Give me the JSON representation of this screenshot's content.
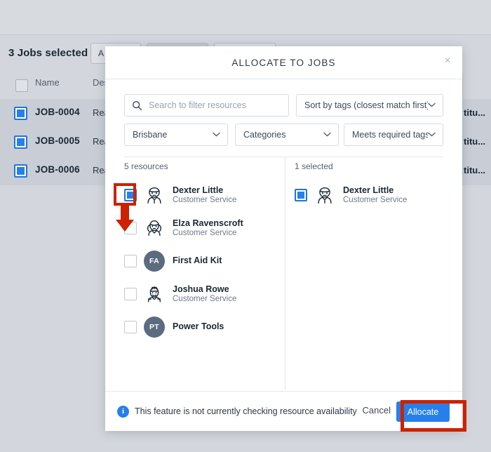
{
  "background": {
    "selection_label": "3 Jobs selected",
    "toolbar_buttons": [
      {
        "label": "A"
      },
      {
        "label": ""
      },
      {
        "label": ""
      }
    ],
    "table": {
      "columns": [
        "Name",
        "Des"
      ],
      "rows": [
        {
          "name": "JOB-0004",
          "description": "Rea",
          "tail": "titu..."
        },
        {
          "name": "JOB-0005",
          "description": "Rea",
          "tail": "titu..."
        },
        {
          "name": "JOB-0006",
          "description": "Rea",
          "tail": "titu..."
        }
      ]
    }
  },
  "modal": {
    "title": "ALLOCATE TO JOBS",
    "close_label": "×",
    "search": {
      "placeholder": "Search to filter resources",
      "value": ""
    },
    "sort_select": {
      "value": "Sort by tags (closest match first)"
    },
    "location_select": {
      "value": "Brisbane"
    },
    "category_select": {
      "value": "Categories"
    },
    "tags_select": {
      "value": "Meets required tags"
    },
    "left_panel": {
      "count_label": "5 resources",
      "resources": [
        {
          "name": "Dexter Little",
          "role": "Customer Service",
          "avatar": "person",
          "checked": true
        },
        {
          "name": "Elza Ravenscroft",
          "role": "Customer Service",
          "avatar": "person",
          "checked": false
        },
        {
          "name": "First Aid Kit",
          "role": "",
          "avatar": "FA",
          "checked": false
        },
        {
          "name": "Joshua Rowe",
          "role": "Customer Service",
          "avatar": "person",
          "checked": false
        },
        {
          "name": "Power Tools",
          "role": "",
          "avatar": "PT",
          "checked": false
        }
      ]
    },
    "right_panel": {
      "count_label": "1 selected",
      "resources": [
        {
          "name": "Dexter Little",
          "role": "Customer Service",
          "avatar": "person",
          "checked": true
        }
      ]
    },
    "footer": {
      "note": "This feature is not currently checking resource availability",
      "info_icon_label": "i",
      "cancel_label": "Cancel",
      "allocate_label": "Allocate"
    }
  },
  "annotation": {
    "color": "#cc2200"
  }
}
